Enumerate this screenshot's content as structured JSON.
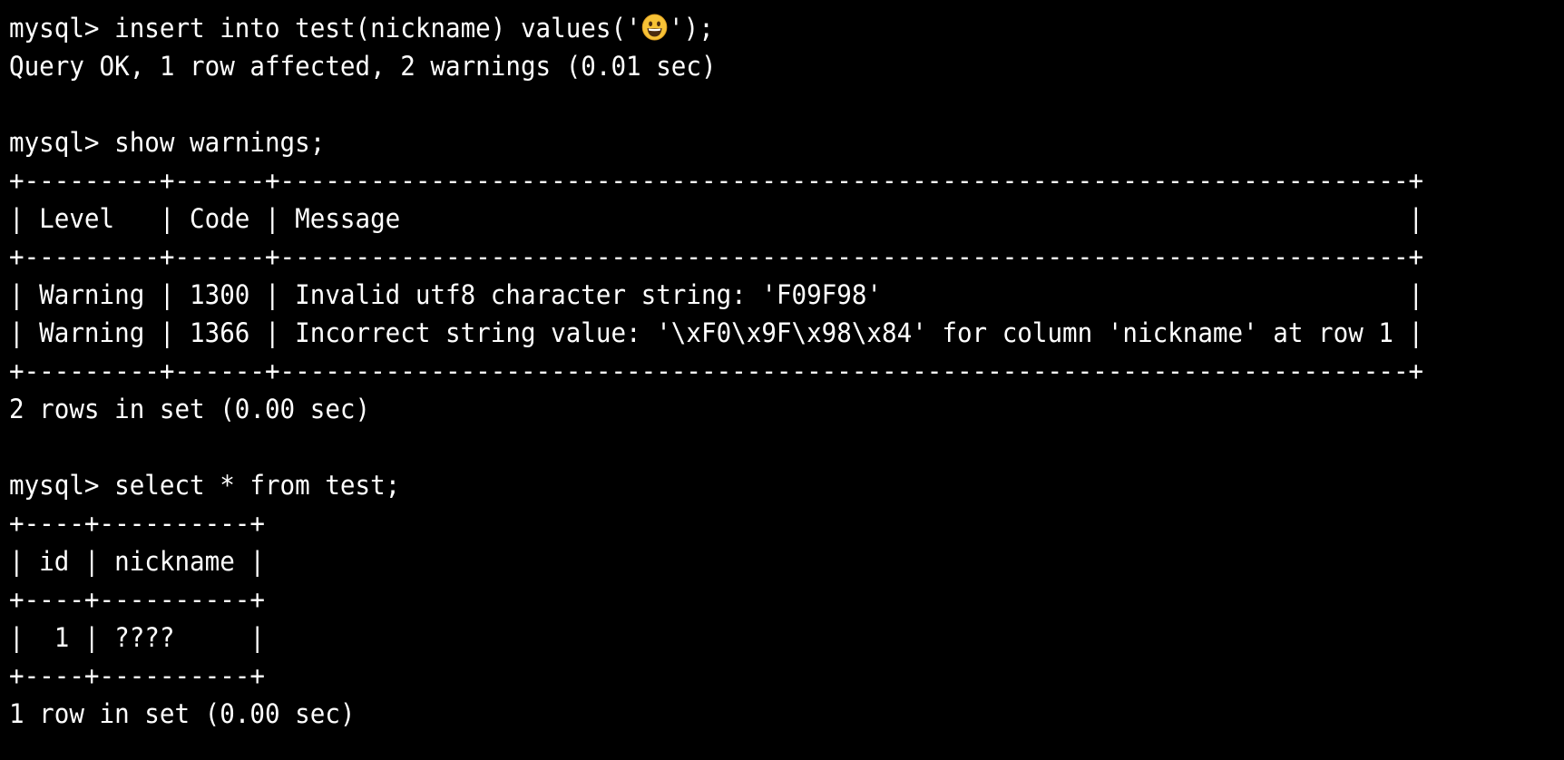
{
  "terminal": {
    "background": "#000000",
    "foreground": "#ffffff",
    "cmd1": {
      "prefix": "mysql> insert into test(nickname) values('",
      "emoji_name": "grinning-face-icon",
      "suffix": "');"
    },
    "lines": [
      "Query OK, 1 row affected, 2 warnings (0.01 sec)",
      "",
      "mysql> show warnings;",
      "+---------+------+---------------------------------------------------------------------------+",
      "| Level   | Code | Message                                                                   |",
      "+---------+------+---------------------------------------------------------------------------+",
      "| Warning | 1300 | Invalid utf8 character string: 'F09F98'                                   |",
      "| Warning | 1366 | Incorrect string value: '\\xF0\\x9F\\x98\\x84' for column 'nickname' at row 1 |",
      "+---------+------+---------------------------------------------------------------------------+",
      "2 rows in set (0.00 sec)",
      "",
      "mysql> select * from test;",
      "+----+----------+",
      "| id | nickname |",
      "+----+----------+",
      "|  1 | ????     |",
      "+----+----------+",
      "1 row in set (0.00 sec)"
    ]
  }
}
